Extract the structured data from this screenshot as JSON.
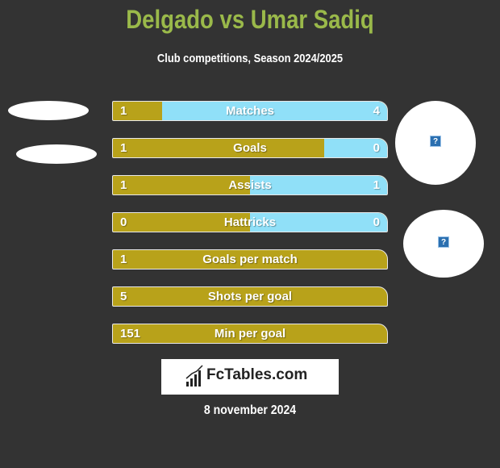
{
  "header": {
    "title": "Delgado vs Umar Sadiq",
    "subtitle": "Club competitions, Season 2024/2025"
  },
  "colors": {
    "title": "#9ab94a",
    "left_bar": "#b8a21a",
    "right_bar": "#90e0f8",
    "background": "#333333"
  },
  "stats": [
    {
      "label": "Matches",
      "left": "1",
      "right": "4",
      "right_share": 0.82
    },
    {
      "label": "Goals",
      "left": "1",
      "right": "0",
      "right_share": 0.23
    },
    {
      "label": "Assists",
      "left": "1",
      "right": "1",
      "right_share": 0.5
    },
    {
      "label": "Hattricks",
      "left": "0",
      "right": "0",
      "right_share": 0.5
    },
    {
      "label": "Goals per match",
      "left": "1",
      "right": "",
      "right_share": 0
    },
    {
      "label": "Shots per goal",
      "left": "5",
      "right": "",
      "right_share": 0
    },
    {
      "label": "Min per goal",
      "left": "151",
      "right": "",
      "right_share": 0
    }
  ],
  "right_images": [
    {
      "icon": "?"
    },
    {
      "icon": "?"
    }
  ],
  "logo": {
    "text": "FcTables.com"
  },
  "footer": {
    "date": "8 november 2024"
  }
}
